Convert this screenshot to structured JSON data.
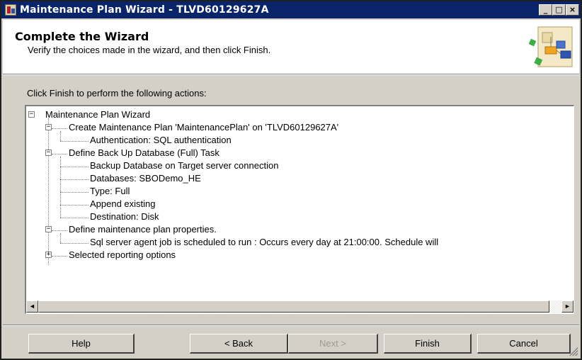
{
  "window": {
    "title": "Maintenance Plan Wizard - TLVD60129627A",
    "caption_buttons": [
      "_",
      "□",
      "×"
    ]
  },
  "header": {
    "title": "Complete the Wizard",
    "subtitle": "Verify the choices made in the wizard, and then click Finish."
  },
  "instruction": "Click Finish to perform the following actions:",
  "tree": {
    "root": {
      "label": "Maintenance Plan Wizard",
      "expander": "−"
    },
    "nodes": [
      {
        "label": "Create Maintenance Plan 'MaintenancePlan' on 'TLVD60129627A'",
        "expander": "−"
      },
      {
        "label": "Authentication: SQL authentication"
      },
      {
        "label": "Define Back Up Database (Full) Task",
        "expander": "−"
      },
      {
        "label": "Backup Database on Target server connection"
      },
      {
        "label": "Databases: SBODemo_HE"
      },
      {
        "label": "Type: Full"
      },
      {
        "label": "Append existing"
      },
      {
        "label": "Destination: Disk"
      },
      {
        "label": "Define maintenance plan properties.",
        "expander": "−"
      },
      {
        "label": "Sql server agent job is scheduled to run : Occurs every day at 21:00:00. Schedule will"
      },
      {
        "label": "Selected reporting options",
        "expander": "+"
      }
    ]
  },
  "scrollbar": {
    "left_arrow": "◄",
    "right_arrow": "►"
  },
  "buttons": {
    "help": "Help",
    "back": "< Back",
    "next": "Next >",
    "finish": "Finish",
    "cancel": "Cancel"
  },
  "colors": {
    "titlebar": "#0a246a",
    "dialog_face": "#d4d0c8",
    "header_bg": "#ffffff",
    "disabled_text": "#9c9a94"
  }
}
